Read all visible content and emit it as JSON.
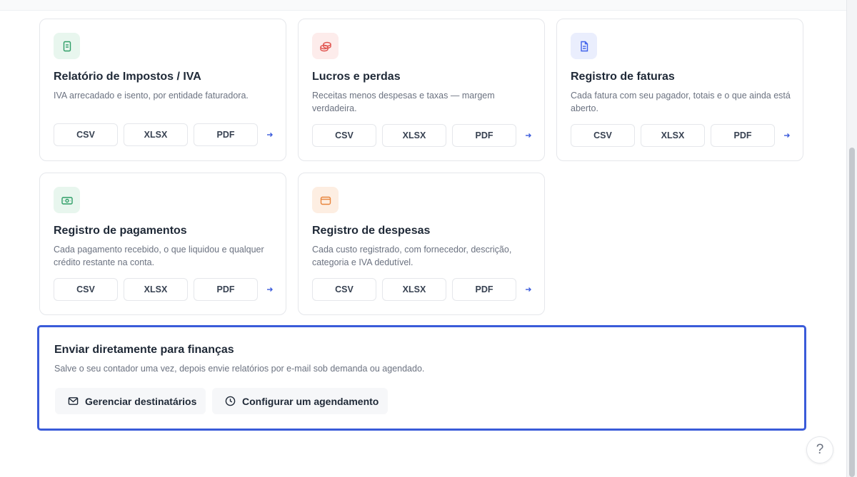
{
  "reports": [
    {
      "title": "Relatório de Impostos / IVA",
      "description": "IVA arrecadado e isento, por entidade faturadora.",
      "icon": "receipt-icon",
      "accent": "#2f9e67",
      "formats": [
        "CSV",
        "XLSX",
        "PDF"
      ]
    },
    {
      "title": "Lucros e perdas",
      "description": "Receitas menos despesas e taxas — margem verdadeira.",
      "icon": "coins-icon",
      "accent": "#e0524d",
      "formats": [
        "CSV",
        "XLSX",
        "PDF"
      ]
    },
    {
      "title": "Registro de faturas",
      "description": "Cada fatura com seu pagador, totais e o que ainda está aberto.",
      "icon": "invoice-icon",
      "accent": "#4263eb",
      "formats": [
        "CSV",
        "XLSX",
        "PDF"
      ]
    },
    {
      "title": "Registro de pagamentos",
      "description": "Cada pagamento recebido, o que liquidou e qualquer crédito restante na conta.",
      "icon": "banknote-icon",
      "accent": "#2f9e67",
      "formats": [
        "CSV",
        "XLSX",
        "PDF"
      ]
    },
    {
      "title": "Registro de despesas",
      "description": "Cada custo registrado, com fornecedor, descrição, categoria e IVA dedutível.",
      "icon": "wallet-icon",
      "accent": "#e8843c",
      "formats": [
        "CSV",
        "XLSX",
        "PDF"
      ]
    }
  ],
  "finance": {
    "title": "Enviar diretamente para finanças",
    "description": "Salve o seu contador uma vez, depois envie relatórios por e-mail sob demanda ou agendado.",
    "manage_label": "Gerenciar destinatários",
    "schedule_label": "Configurar um agendamento",
    "accent": "#3a5bd9"
  },
  "help": {
    "label": "?"
  }
}
